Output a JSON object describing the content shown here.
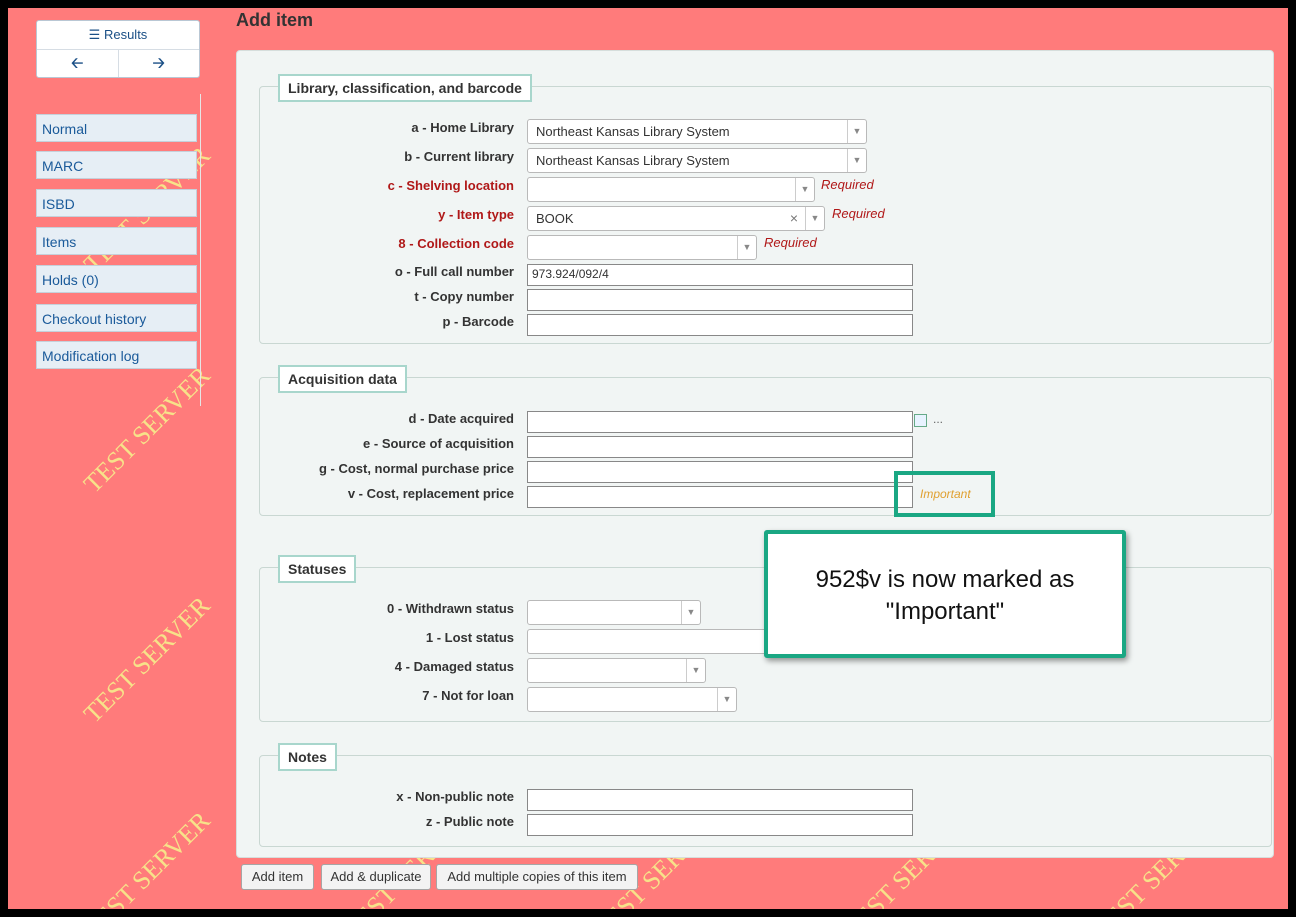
{
  "nav": {
    "results_label": "Results",
    "prev_icon": "arrow-left-icon",
    "next_icon": "arrow-right-icon",
    "items": [
      {
        "label": "Normal"
      },
      {
        "label": "MARC"
      },
      {
        "label": "ISBD"
      },
      {
        "label": "Items"
      },
      {
        "label": "Holds (0)"
      },
      {
        "label": "Checkout history"
      },
      {
        "label": "Modification log"
      }
    ]
  },
  "watermark": "TEST SERVER",
  "page_title": "Add item",
  "sections": {
    "library": {
      "legend": "Library, classification, and barcode",
      "home_library": {
        "label": "a - Home Library",
        "value": "Northeast Kansas Library System"
      },
      "current_library": {
        "label": "b - Current library",
        "value": "Northeast Kansas Library System"
      },
      "shelving_location": {
        "label": "c - Shelving location",
        "value": "",
        "status": "Required"
      },
      "item_type": {
        "label": "y - Item type",
        "value": "BOOK",
        "status": "Required"
      },
      "collection_code": {
        "label": "8 - Collection code",
        "value": "",
        "status": "Required"
      },
      "full_call_number": {
        "label": "o - Full call number",
        "value": "973.924/092/4"
      },
      "copy_number": {
        "label": "t - Copy number",
        "value": ""
      },
      "barcode": {
        "label": "p - Barcode",
        "value": ""
      }
    },
    "acquisition": {
      "legend": "Acquisition data",
      "date_acquired": {
        "label": "d - Date acquired",
        "value": "",
        "extra": "..."
      },
      "source": {
        "label": "e - Source of acquisition",
        "value": ""
      },
      "cost_normal": {
        "label": "g - Cost, normal purchase price",
        "value": ""
      },
      "cost_replacement": {
        "label": "v - Cost, replacement price",
        "value": "",
        "status": "Important"
      }
    },
    "statuses": {
      "legend": "Statuses",
      "withdrawn": {
        "label": "0 - Withdrawn status",
        "value": ""
      },
      "lost": {
        "label": "1 - Lost status",
        "value": ""
      },
      "damaged": {
        "label": "4 - Damaged status",
        "value": ""
      },
      "not_for_loan": {
        "label": "7 - Not for loan",
        "value": ""
      }
    },
    "notes": {
      "legend": "Notes",
      "nonpublic": {
        "label": "x - Non-public note",
        "value": ""
      },
      "public": {
        "label": "z - Public note",
        "value": ""
      }
    }
  },
  "buttons": {
    "add_item": "Add item",
    "add_duplicate": "Add & duplicate",
    "add_multiple": "Add multiple copies of this item"
  },
  "callout": {
    "line1": "952$v is now marked as",
    "line2": "\"Important\""
  },
  "colors": {
    "background": "#ff7b7b",
    "required": "#b01818",
    "important": "#e0a030",
    "highlight": "#1aa783"
  }
}
